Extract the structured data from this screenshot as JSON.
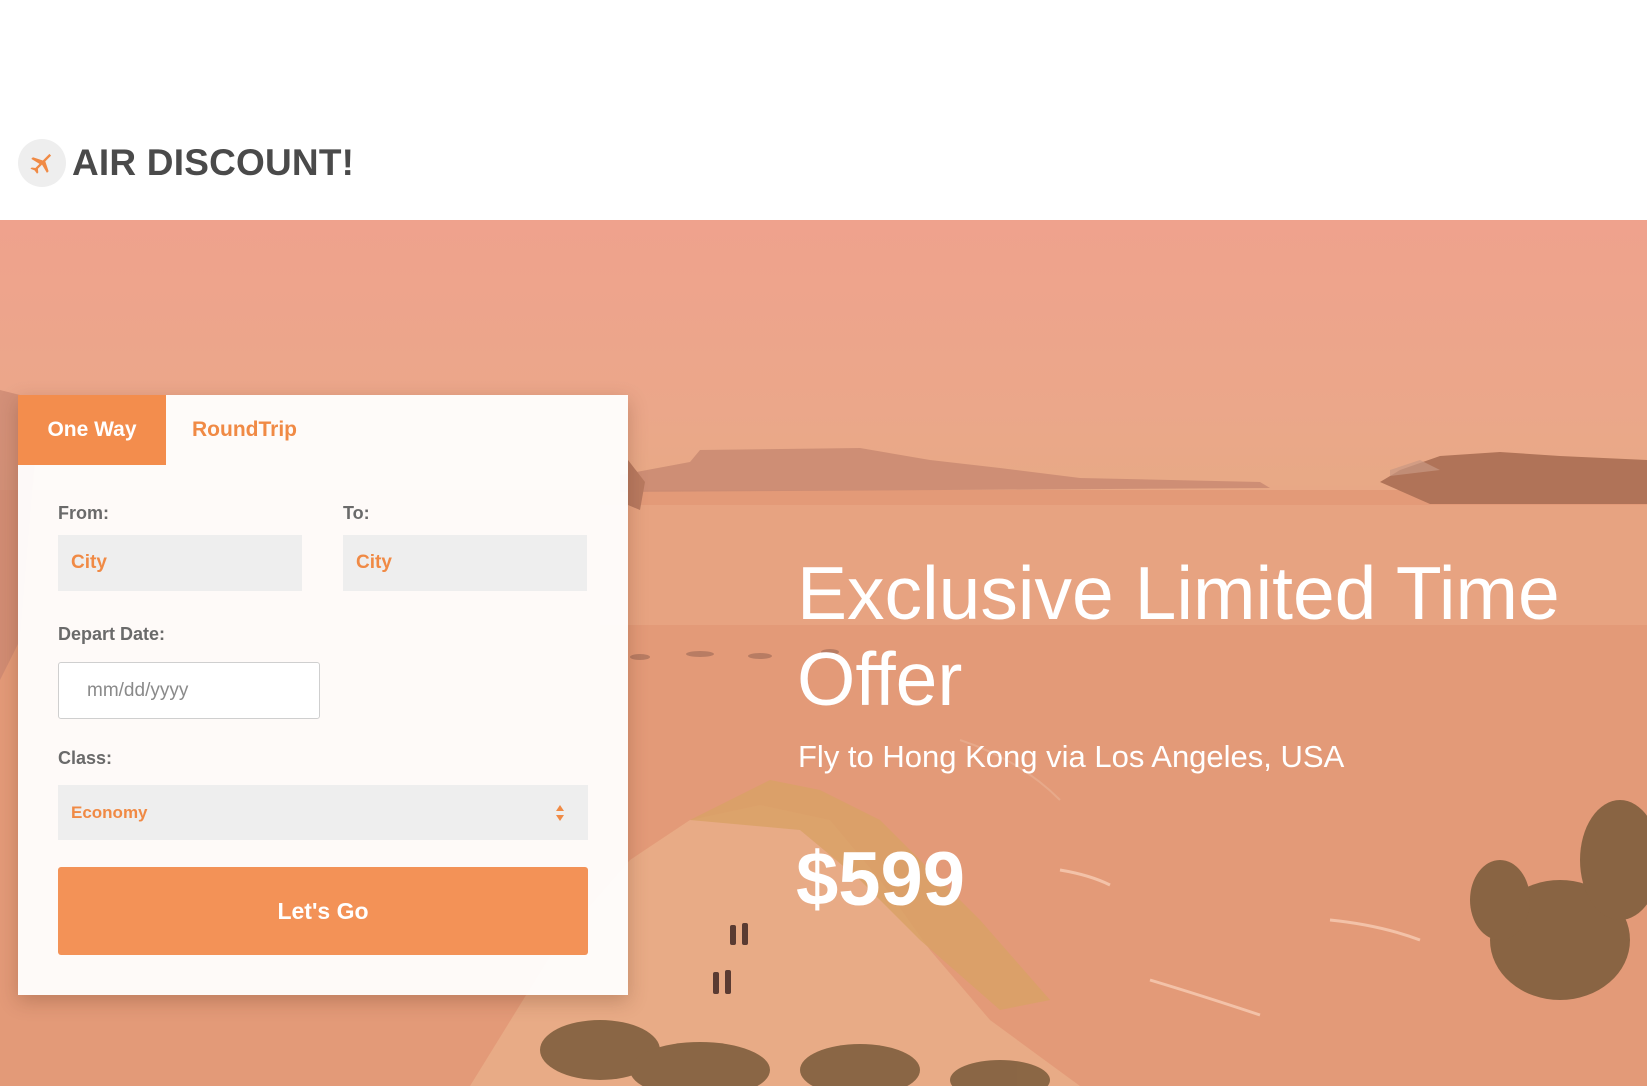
{
  "brand": {
    "name": "AIR DISCOUNT!",
    "icon": "airplane-icon",
    "accent_color": "#f38d4d"
  },
  "booking": {
    "tabs": [
      {
        "label": "One Way",
        "active": true
      },
      {
        "label": "RoundTrip",
        "active": false
      }
    ],
    "from": {
      "label": "From:",
      "placeholder": "City"
    },
    "to": {
      "label": "To:",
      "placeholder": "City"
    },
    "depart": {
      "label": "Depart Date:",
      "placeholder": "mm/dd/yyyy"
    },
    "class": {
      "label": "Class:",
      "selected": "Economy"
    },
    "submit_label": "Let's Go"
  },
  "offer": {
    "title_line1": "Exclusive Limited Time",
    "title_line2": "Offer",
    "subtitle": "Fly to Hong Kong via Los Angeles, USA",
    "price": "$599"
  }
}
